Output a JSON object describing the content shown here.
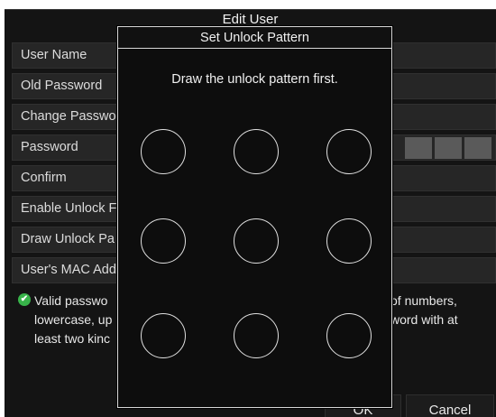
{
  "window": {
    "title": "Edit User"
  },
  "form": {
    "rows": [
      {
        "label": "User Name"
      },
      {
        "label": "Old Password"
      },
      {
        "label": "Change Passwo"
      },
      {
        "label": "Password"
      },
      {
        "label": "Confirm"
      },
      {
        "label": "Enable Unlock F"
      },
      {
        "label": "Draw Unlock Pa"
      },
      {
        "label": "User's MAC Add"
      }
    ]
  },
  "info": {
    "icon": "check-icon",
    "line1_left": "Valid passwo",
    "line1_right": "of numbers,",
    "line2_left": "lowercase, up",
    "line2_right": "word with at",
    "line3_left": "least two kinc"
  },
  "footer": {
    "ok_label": "OK",
    "cancel_label": "Cancel"
  },
  "modal": {
    "title": "Set Unlock Pattern",
    "message": "Draw the unlock pattern first.",
    "grid": {
      "rows": 3,
      "cols": 3
    }
  },
  "colors": {
    "background": "#141414",
    "field": "#262626",
    "modal_border": "#d8d8d8",
    "check": "#38b44a"
  }
}
